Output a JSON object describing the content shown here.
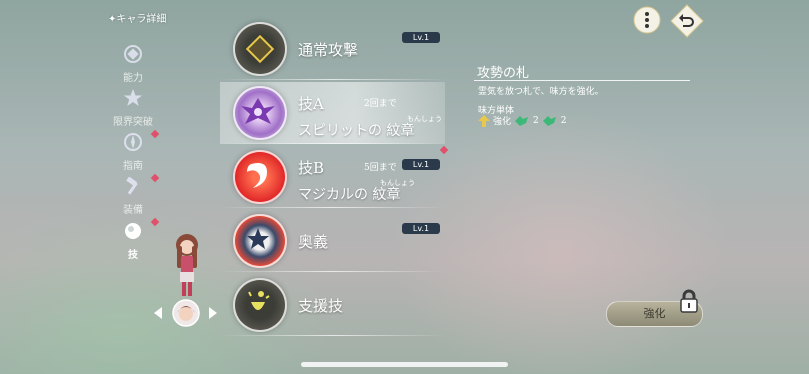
{
  "nav": {
    "title": "キャラ詳細",
    "items": [
      {
        "label": "能力"
      },
      {
        "label": "限界突破"
      },
      {
        "label": "指南"
      },
      {
        "label": "装備"
      },
      {
        "label": "技"
      }
    ]
  },
  "skills": [
    {
      "name": "通常攻撃",
      "level": "Lv.1"
    },
    {
      "name": "技A",
      "uses": "2回まで",
      "subtitle": "スピリットの 紋章",
      "ruby": "もんしょう"
    },
    {
      "name": "技B",
      "uses": "5回まで",
      "level": "Lv.1",
      "subtitle": "マジカルの 紋章",
      "ruby": "もんしょう"
    },
    {
      "name": "奥義",
      "level": "Lv.1"
    },
    {
      "name": "支援技"
    }
  ],
  "detail": {
    "title": "攻勢の札",
    "description": "霊気を放つ札で、味方を強化。",
    "target": "味方単体",
    "effect_label": "強化",
    "effect_count_1": "2",
    "effect_count_2": "2"
  },
  "enhance_button": {
    "label": "強化"
  },
  "colors": {
    "accent_gold": "#e8c84a",
    "badge_navy": "#2b3a4a",
    "dot_red": "#e0506a"
  }
}
